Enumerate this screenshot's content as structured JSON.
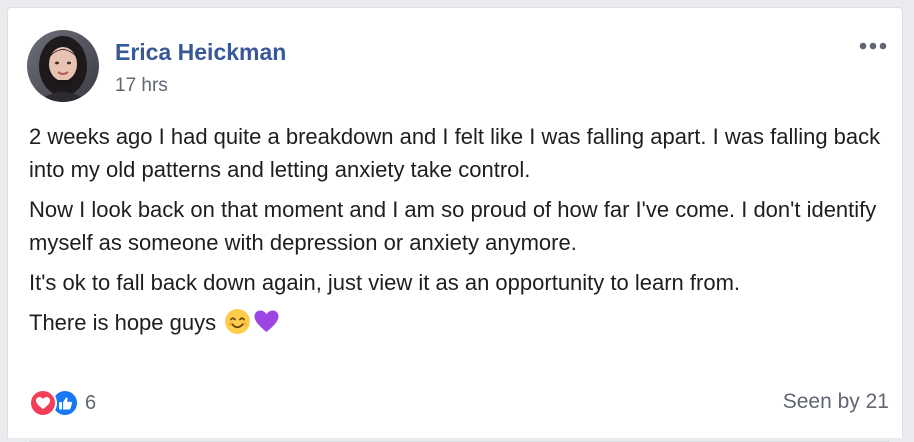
{
  "post": {
    "author": "Erica Heickman",
    "timestamp": "17 hrs",
    "more_icon": "more-horizontal-icon",
    "paragraphs": [
      "2 weeks ago I had quite a breakdown and I felt like I was falling apart. I was falling back into my old patterns and letting anxiety take control.",
      "Now I look back on that moment and I am so proud of how far I've come. I don't identify myself as someone with depression or anxiety anymore.",
      "It's ok to fall back down again, just view it as an opportunity to learn from.",
      "There is hope guys"
    ],
    "trailing_emojis": [
      "smiling-face-emoji",
      "purple-heart-emoji"
    ]
  },
  "footer": {
    "reaction_icons": [
      "love-reaction-icon",
      "like-reaction-icon"
    ],
    "reaction_count": "6",
    "seen_by": "Seen by 21"
  },
  "colors": {
    "author_link": "#385898",
    "secondary_text": "#606770",
    "body_text": "#1c1e21",
    "love": "#f33e58",
    "like": "#1877f2"
  }
}
